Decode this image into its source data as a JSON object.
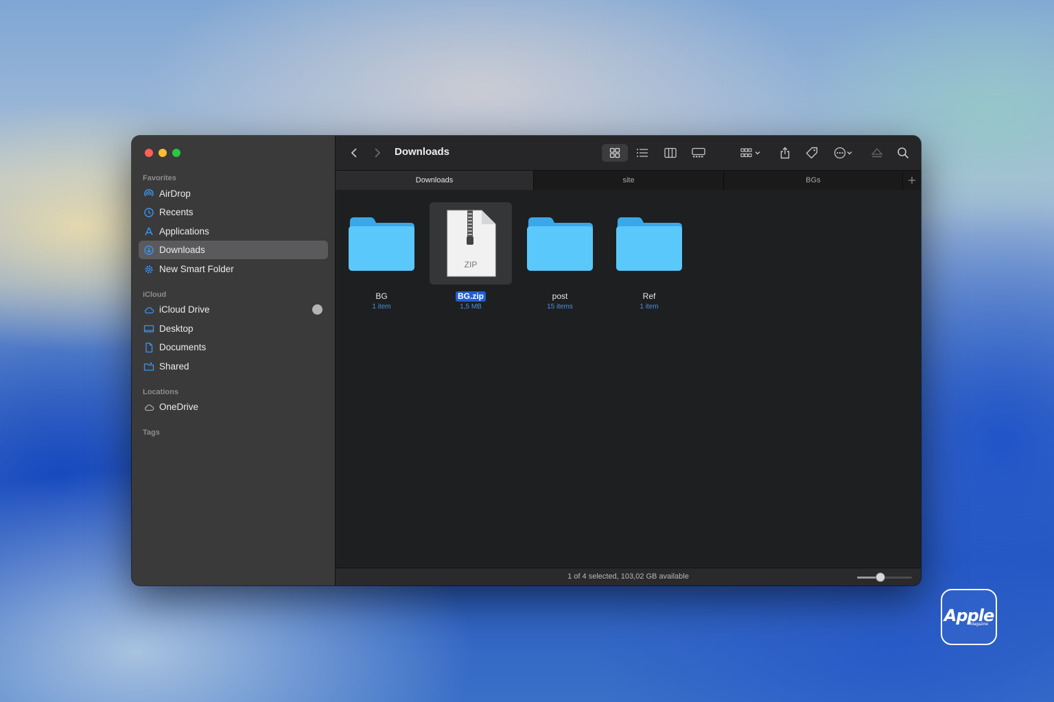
{
  "window": {
    "title": "Downloads"
  },
  "sidebar": {
    "sections": [
      {
        "title": "Favorites",
        "items": [
          {
            "label": "AirDrop",
            "icon": "airdrop-icon"
          },
          {
            "label": "Recents",
            "icon": "clock-icon"
          },
          {
            "label": "Applications",
            "icon": "applications-icon"
          },
          {
            "label": "Downloads",
            "icon": "download-icon",
            "selected": true
          },
          {
            "label": "New Smart Folder",
            "icon": "gear-icon"
          }
        ]
      },
      {
        "title": "iCloud",
        "items": [
          {
            "label": "iCloud Drive",
            "icon": "cloud-icon"
          },
          {
            "label": "Desktop",
            "icon": "desktop-icon"
          },
          {
            "label": "Documents",
            "icon": "document-icon"
          },
          {
            "label": "Shared",
            "icon": "shared-folder-icon"
          }
        ]
      },
      {
        "title": "Locations",
        "items": [
          {
            "label": "OneDrive",
            "icon": "cloud-icon"
          }
        ]
      },
      {
        "title": "Tags",
        "items": []
      }
    ]
  },
  "toolbar": {
    "view_modes": [
      "icon-view",
      "list-view",
      "column-view",
      "gallery-view"
    ],
    "active_view": "icon-view"
  },
  "tabs": [
    {
      "label": "Downloads",
      "active": true
    },
    {
      "label": "site",
      "active": false
    },
    {
      "label": "BGs",
      "active": false
    }
  ],
  "files": [
    {
      "name": "BG",
      "meta": "1 item",
      "type": "folder",
      "selected": false
    },
    {
      "name": "BG.zip",
      "meta": "1,5 MB",
      "type": "zip",
      "badge": "ZIP",
      "selected": true
    },
    {
      "name": "post",
      "meta": "15 items",
      "type": "folder",
      "selected": false
    },
    {
      "name": "Ref",
      "meta": "1 item",
      "type": "folder",
      "selected": false
    }
  ],
  "status": {
    "text": "1 of 4 selected, 103,02 GB available",
    "icon_size_fraction": 0.42
  },
  "colors": {
    "accent": "#1f5ed9",
    "folder": "#5ac8fa",
    "folder_dark": "#3aa8e8",
    "meta": "#4a90e2"
  },
  "watermark": {
    "main": "Apple",
    "sub": "Magazine"
  }
}
